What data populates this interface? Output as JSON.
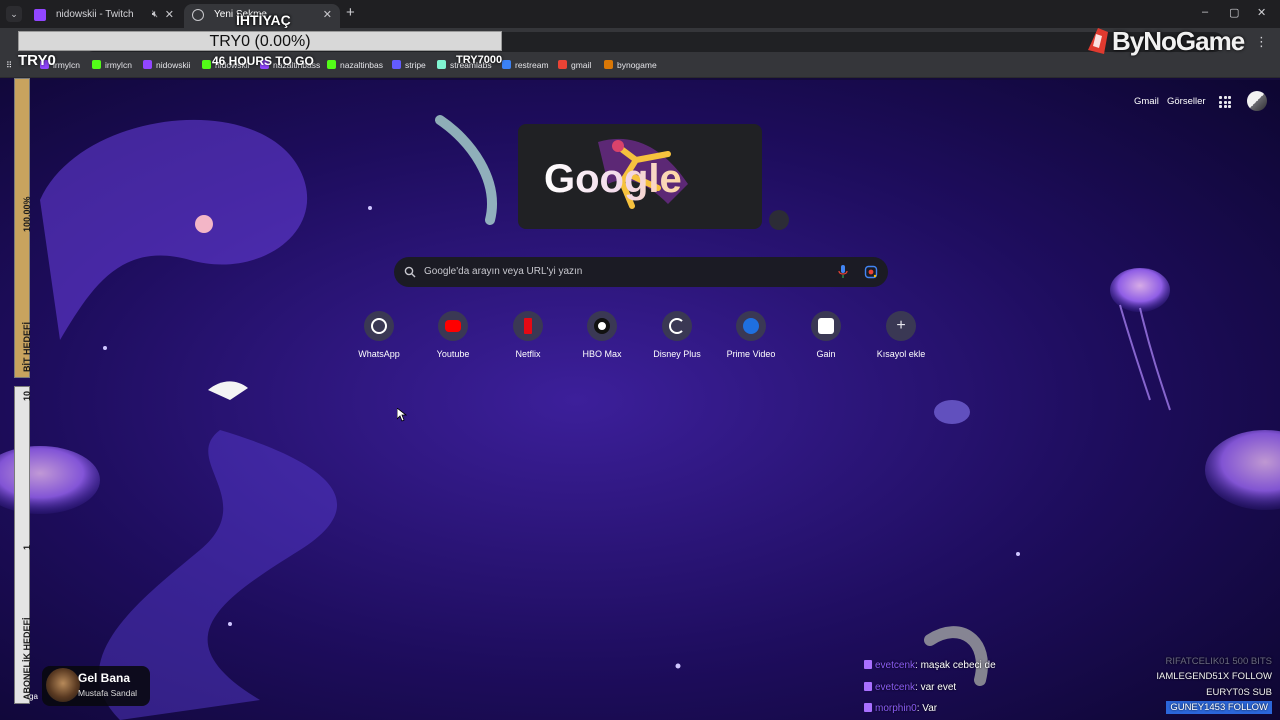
{
  "browser": {
    "tabs": [
      {
        "label": "nidowskii - Twitch",
        "icon": "twitch-icon",
        "active": false,
        "muted": true
      },
      {
        "label": "Yeni Sekme",
        "icon": "globe-icon",
        "active": true,
        "muted": false
      }
    ],
    "new_tab_symbol": "+",
    "window_controls": {
      "minimize": "–",
      "maximize": "▢",
      "close": "✕"
    },
    "bookmarks": [
      {
        "label": "irmylcn",
        "icon": "twitch-icon",
        "color": "#9146ff"
      },
      {
        "label": "irmylcn",
        "icon": "kick-icon",
        "color": "#53fc18"
      },
      {
        "label": "nidowskii",
        "icon": "twitch-icon",
        "color": "#9146ff"
      },
      {
        "label": "nidowskii",
        "icon": "kick-icon",
        "color": "#53fc18"
      },
      {
        "label": "nazaltinbass",
        "icon": "twitch-icon",
        "color": "#9146ff"
      },
      {
        "label": "nazaltinbas",
        "icon": "kick-icon",
        "color": "#53fc18"
      },
      {
        "label": "stripe",
        "icon": "stripe-icon",
        "color": "#635bff"
      },
      {
        "label": "streamlabs",
        "icon": "streamlabs-icon",
        "color": "#80f5d2"
      },
      {
        "label": "restream",
        "icon": "restream-icon",
        "color": "#3b82f6"
      },
      {
        "label": "gmail",
        "icon": "gmail-icon",
        "color": "#ea4335"
      },
      {
        "label": "bynogame",
        "icon": "bynogame-icon",
        "color": "#d97706"
      }
    ]
  },
  "overlay": {
    "goal": {
      "title": "İHTİYAÇ",
      "amount": "TRY0 (0.00%)",
      "progress": 0,
      "current": "TRY0",
      "time_left": "46 HOURS TO GO",
      "target": "TRY7000"
    },
    "brand": "ByNoGame",
    "bits_goal": {
      "label": "BİT HEDEFİ",
      "percent": "100.00%"
    },
    "sub_goal": {
      "label": "ABONELİK HEDEFİ",
      "target": "10",
      "current": "1"
    }
  },
  "newtab": {
    "top_links": {
      "gmail": "Gmail",
      "images": "Görseller"
    },
    "doodle_text": "Google",
    "search_placeholder": "Google'da arayın veya URL'yi yazın",
    "shortcuts": [
      {
        "label": "WhatsApp",
        "icon": "whatsapp-icon",
        "color": "#25d366"
      },
      {
        "label": "Youtube",
        "icon": "youtube-icon",
        "color": "#ff0000"
      },
      {
        "label": "Netflix",
        "icon": "netflix-icon",
        "color": "#e50914"
      },
      {
        "label": "HBO Max",
        "icon": "hbomax-icon",
        "color": "#ffffff"
      },
      {
        "label": "Disney Plus",
        "icon": "disneyplus-icon",
        "color": "#113ccf"
      },
      {
        "label": "Prime Video",
        "icon": "primevideo-icon",
        "color": "#1f6fe0"
      },
      {
        "label": "Gain",
        "icon": "gain-icon",
        "color": "#ffffff"
      },
      {
        "label": "Kısayol ekle",
        "icon": "plus-icon",
        "color": "#e8e8ee"
      }
    ]
  },
  "chat": [
    {
      "user": "evetcenk",
      "message": "maşak cebeci de"
    },
    {
      "user": "evetcenk",
      "message": "var evet"
    },
    {
      "user": "morphin0",
      "message": "Var"
    }
  ],
  "alerts": [
    {
      "user": "RIFATCELIK01",
      "event": "500 BITS"
    },
    {
      "user": "IAMLEGEND51X",
      "event": "FOLLOW"
    },
    {
      "user": "EURYT0S",
      "event": "SUB"
    },
    {
      "user": "GUNEY1453",
      "event": "FOLLOW"
    }
  ],
  "now_playing": {
    "song": "Gel Bana",
    "artist": "Mustafa Sandal",
    "side_text": "ga"
  }
}
